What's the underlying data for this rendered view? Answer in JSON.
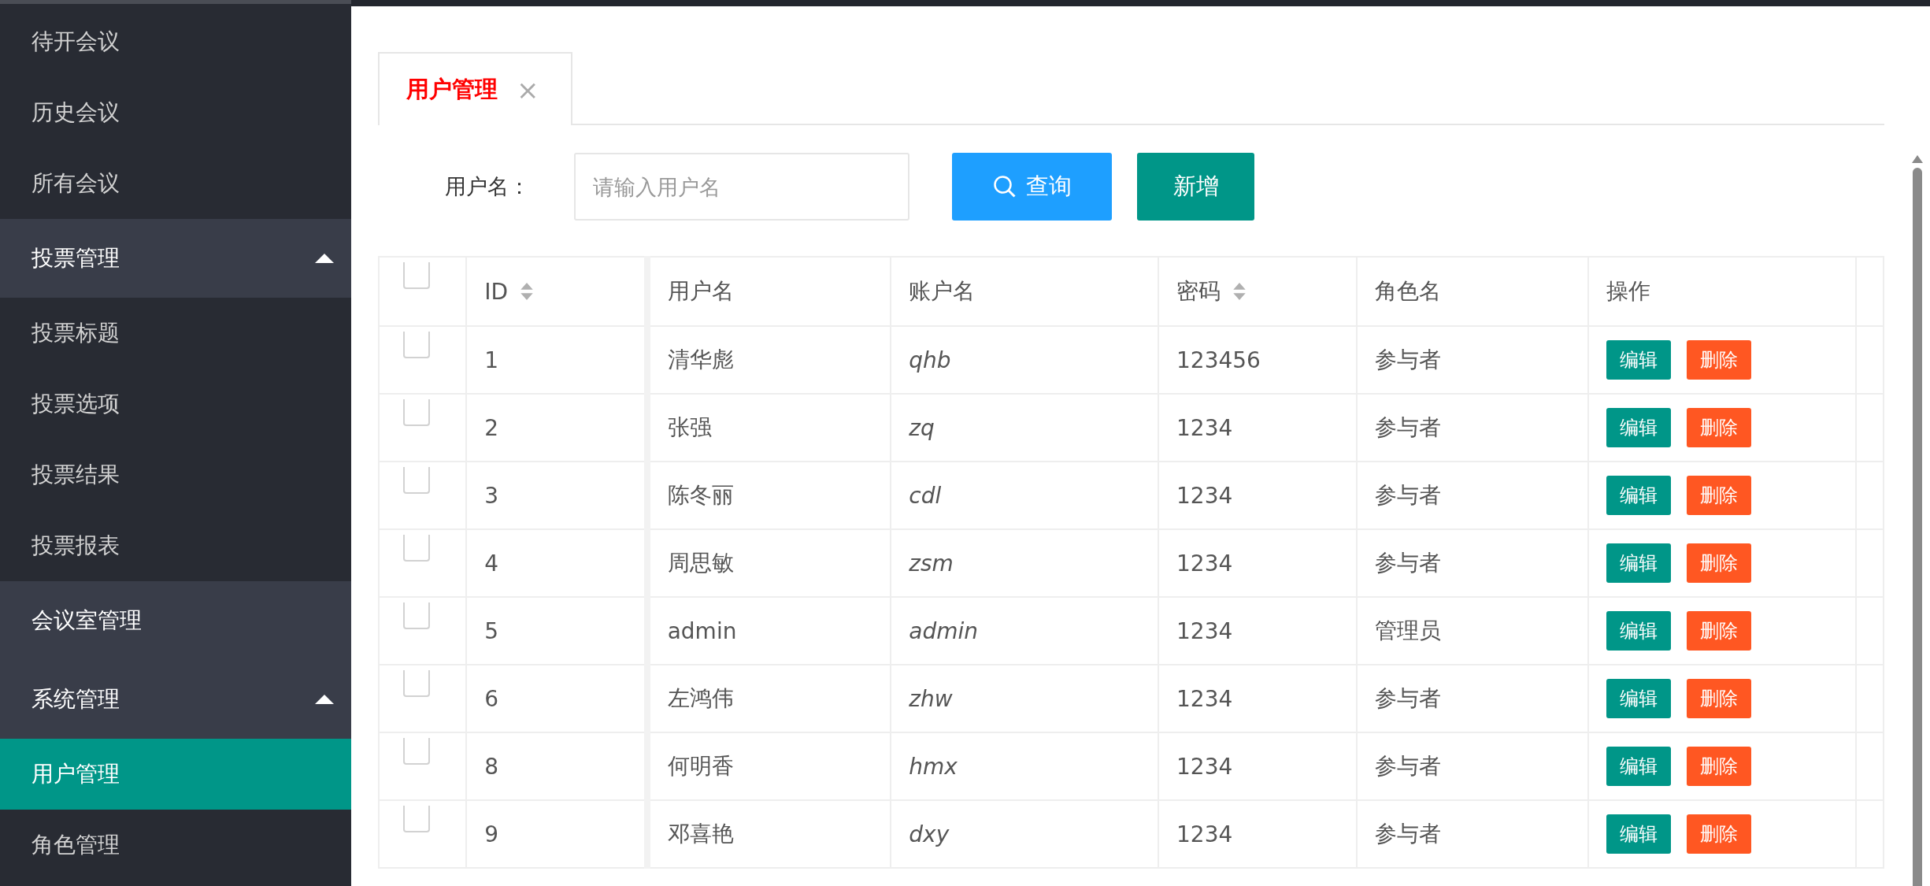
{
  "sidebar": {
    "items": [
      {
        "label": "待开会议",
        "kind": "sub",
        "selected": false
      },
      {
        "label": "历史会议",
        "kind": "sub",
        "selected": false
      },
      {
        "label": "所有会议",
        "kind": "sub",
        "selected": false
      },
      {
        "label": "投票管理",
        "kind": "group",
        "expanded": true,
        "children": [
          {
            "label": "投票标题",
            "selected": false
          },
          {
            "label": "投票选项",
            "selected": false
          },
          {
            "label": "投票结果",
            "selected": false
          },
          {
            "label": "投票报表",
            "selected": false
          }
        ]
      },
      {
        "label": "会议室管理",
        "kind": "top",
        "selected": false
      },
      {
        "label": "系统管理",
        "kind": "group",
        "expanded": true,
        "children": [
          {
            "label": "用户管理",
            "selected": true
          },
          {
            "label": "角色管理",
            "selected": false
          }
        ]
      }
    ]
  },
  "tabs": [
    {
      "label": "用户管理",
      "close": "×",
      "selected": true
    }
  ],
  "search": {
    "label": "用户名：",
    "placeholder": "请输入用户名",
    "buttons": [
      {
        "label": "查询",
        "kind": "search"
      },
      {
        "label": "新增",
        "kind": "add"
      }
    ]
  },
  "table": {
    "columns": [
      {
        "label": "ID",
        "sortable": true
      },
      {
        "label": "用户名",
        "sortable": false
      },
      {
        "label": "账户名",
        "sortable": false
      },
      {
        "label": "密码",
        "sortable": true
      },
      {
        "label": "角色名",
        "sortable": false
      },
      {
        "label": "操作",
        "sortable": false
      }
    ],
    "header_checked": false,
    "rows": [
      {
        "checked": false,
        "cells": [
          "1",
          "清华彪",
          "qhb",
          "123456",
          "参与者"
        ],
        "actions": [
          "编辑",
          "删除"
        ]
      },
      {
        "checked": false,
        "cells": [
          "2",
          "张强",
          "zq",
          "1234",
          "参与者"
        ],
        "actions": [
          "编辑",
          "删除"
        ]
      },
      {
        "checked": false,
        "cells": [
          "3",
          "陈冬丽",
          "cdl",
          "1234",
          "参与者"
        ],
        "actions": [
          "编辑",
          "删除"
        ]
      },
      {
        "checked": false,
        "cells": [
          "4",
          "周思敏",
          "zsm",
          "1234",
          "参与者"
        ],
        "actions": [
          "编辑",
          "删除"
        ]
      },
      {
        "checked": false,
        "cells": [
          "5",
          "admin",
          "admin",
          "1234",
          "管理员"
        ],
        "actions": [
          "编辑",
          "删除"
        ]
      },
      {
        "checked": false,
        "cells": [
          "6",
          "左鸿伟",
          "zhw",
          "1234",
          "参与者"
        ],
        "actions": [
          "编辑",
          "删除"
        ]
      },
      {
        "checked": false,
        "cells": [
          "8",
          "何明香",
          "hmx",
          "1234",
          "参与者"
        ],
        "actions": [
          "编辑",
          "删除"
        ]
      },
      {
        "checked": false,
        "cells": [
          "9",
          "邓喜艳",
          "dxy",
          "1234",
          "参与者"
        ],
        "actions": [
          "编辑",
          "删除"
        ]
      }
    ]
  }
}
